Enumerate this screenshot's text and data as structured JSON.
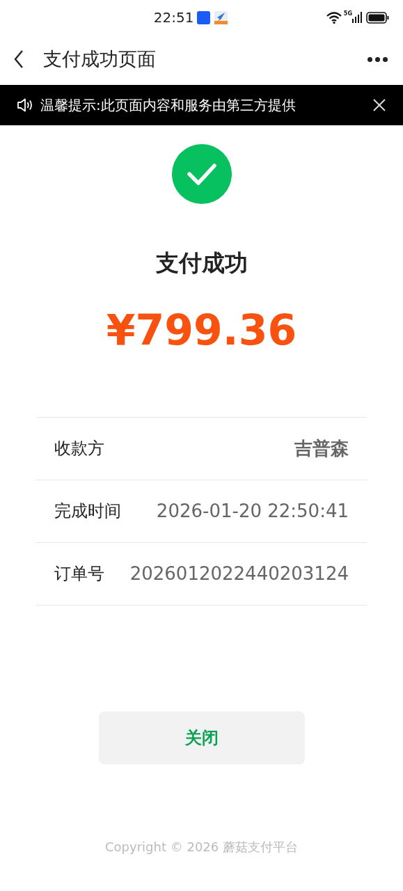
{
  "status_bar": {
    "time": "22:51",
    "network": "5G"
  },
  "nav": {
    "title": "支付成功页面"
  },
  "notice": {
    "text": "温馨提示:此页面内容和服务由第三方提供"
  },
  "result": {
    "title": "支付成功",
    "amount": "¥799.36"
  },
  "details": [
    {
      "kind": "emphasis",
      "label": "收款方",
      "value": "吉普森"
    },
    {
      "kind": "plain",
      "label": "完成时间",
      "value": "2026-01-20 22:50:41"
    },
    {
      "kind": "plain",
      "label": "订单号",
      "value": "2026012022440203124"
    }
  ],
  "button": {
    "label": "关闭"
  },
  "footer": {
    "text": "Copyright © 2026 蘑菇支付平台"
  }
}
